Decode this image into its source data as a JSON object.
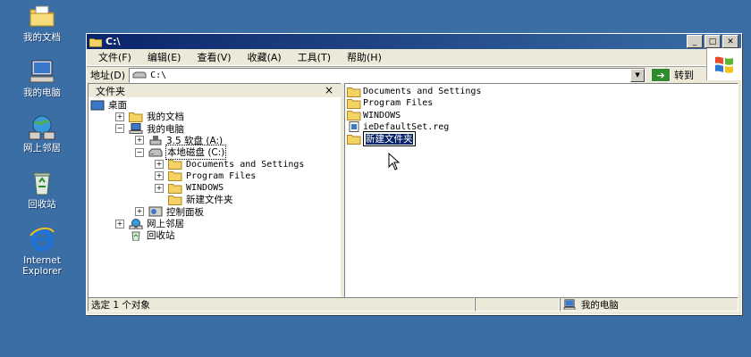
{
  "desktop": {
    "icons": [
      {
        "label": "我的文档",
        "icon": "my-documents-icon"
      },
      {
        "label": "我的电脑",
        "icon": "my-computer-icon"
      },
      {
        "label": "网上邻居",
        "icon": "network-places-icon"
      },
      {
        "label": "回收站",
        "icon": "recycle-bin-icon"
      },
      {
        "label": "Internet\nExplorer",
        "icon": "internet-explorer-icon"
      }
    ]
  },
  "window": {
    "title": "C:\\",
    "menu": [
      "文件(F)",
      "编辑(E)",
      "查看(V)",
      "收藏(A)",
      "工具(T)",
      "帮助(H)"
    ],
    "address": {
      "label": "地址(D)",
      "value": "C:\\",
      "go_label": "转到"
    },
    "folders_pane": {
      "title": "文件夹",
      "close": "×",
      "tree": [
        {
          "label": "桌面",
          "level": 0,
          "expander": "",
          "icon": "desktop-icon",
          "mono": false
        },
        {
          "label": "我的文档",
          "level": 1,
          "expander": "+",
          "icon": "folder-icon",
          "mono": false
        },
        {
          "label": "我的电脑",
          "level": 1,
          "expander": "−",
          "icon": "my-computer-icon",
          "mono": false
        },
        {
          "label": "3.5 软盘 (A:)",
          "level": 2,
          "expander": "+",
          "icon": "floppy-icon",
          "mono": false
        },
        {
          "label": "本地磁盘 (C:)",
          "level": 2,
          "expander": "−",
          "icon": "drive-icon",
          "mono": false,
          "selected": true
        },
        {
          "label": "Documents and Settings",
          "level": 3,
          "expander": "+",
          "icon": "folder-icon",
          "mono": true
        },
        {
          "label": "Program Files",
          "level": 3,
          "expander": "+",
          "icon": "folder-icon",
          "mono": true
        },
        {
          "label": "WINDOWS",
          "level": 3,
          "expander": "+",
          "icon": "folder-icon",
          "mono": true
        },
        {
          "label": "新建文件夹",
          "level": 3,
          "expander": "",
          "icon": "folder-icon",
          "mono": false
        },
        {
          "label": "控制面板",
          "level": 2,
          "expander": "+",
          "icon": "control-panel-icon",
          "mono": false
        },
        {
          "label": "网上邻居",
          "level": 1,
          "expander": "+",
          "icon": "network-places-icon",
          "mono": false
        },
        {
          "label": "回收站",
          "level": 1,
          "expander": "",
          "icon": "recycle-bin-icon",
          "mono": false
        }
      ]
    },
    "files": [
      {
        "name": "Documents and Settings",
        "icon": "folder-icon"
      },
      {
        "name": "Program Files",
        "icon": "folder-icon"
      },
      {
        "name": "WINDOWS",
        "icon": "folder-icon"
      },
      {
        "name": "ieDefaultSet.reg",
        "icon": "reg-file-icon"
      },
      {
        "name": "新建文件夹",
        "icon": "folder-icon",
        "renaming": true
      }
    ],
    "status": {
      "left": "选定 1 个对象",
      "right": "我的电脑"
    }
  },
  "colors": {
    "desktop": "#3a6ea5",
    "titlebar": "#0a246a",
    "chrome": "#ece9d8",
    "folder": "#f4d264"
  }
}
